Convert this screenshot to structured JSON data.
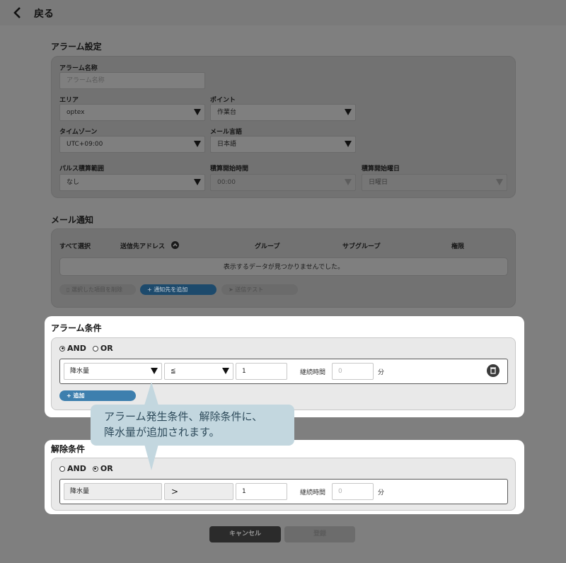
{
  "header": {
    "back_label": "戻る"
  },
  "alarm_settings": {
    "title": "アラーム設定",
    "alarm_name_label": "アラーム名称",
    "alarm_name_placeholder": "アラーム名称",
    "area_label": "エリア",
    "area_value": "optex",
    "point_label": "ポイント",
    "point_value": "作業台",
    "timezone_label": "タイムゾーン",
    "timezone_value": "UTC+09:00",
    "mail_lang_label": "メール言語",
    "mail_lang_value": "日本語",
    "pulse_range_label": "パルス積算範囲",
    "pulse_range_value": "なし",
    "start_time_label": "積算開始時間",
    "start_time_value": "00:00",
    "start_day_label": "積算開始曜日",
    "start_day_value": "日曜日"
  },
  "mail_notify": {
    "title": "メール通知",
    "columns": [
      "すべて選択",
      "送信先アドレス",
      "グループ",
      "サブグループ",
      "権限"
    ],
    "empty_message": "表示するデータが見つかりませんでした。",
    "delete_selected_label": "選択した項目を削除",
    "add_recipient_label": "通知先を追加",
    "send_test_label": "送信テスト"
  },
  "alarm_conditions": {
    "title": "アラーム条件",
    "and_label": "AND",
    "or_label": "OR",
    "selected": "AND",
    "row": {
      "item": "降水量",
      "operator": "≦",
      "value": "1",
      "duration_label": "継続時間",
      "duration_placeholder": "0",
      "unit": "分"
    },
    "add_label": "追加"
  },
  "release_conditions": {
    "title": "解除条件",
    "and_label": "AND",
    "or_label": "OR",
    "selected": "OR",
    "row": {
      "item": "降水量",
      "operator": ">",
      "value": "1",
      "duration_label": "継続時間",
      "duration_placeholder": "0",
      "unit": "分"
    }
  },
  "callout": {
    "line1": "アラーム発生条件、解除条件に、",
    "line2": "降水量が追加されます。"
  },
  "footer": {
    "cancel_label": "キャンセル",
    "register_label": "登録"
  },
  "colors": {
    "overlay": "#7f7f7f",
    "callout_bg": "#c3d7df",
    "callout_text": "#2e4b5b",
    "primary": "#1d4a6c"
  }
}
